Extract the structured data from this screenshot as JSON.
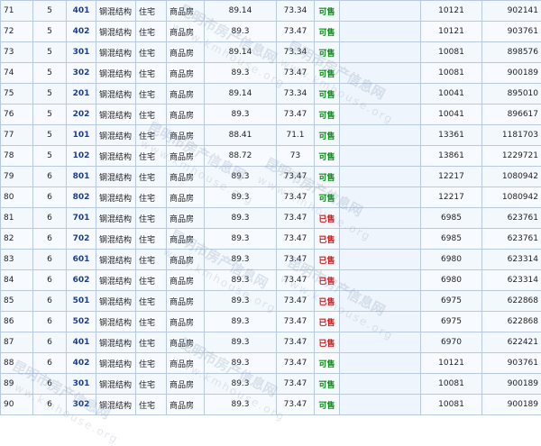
{
  "rows": [
    {
      "no": "71",
      "floor": "5",
      "room": "401",
      "structure": "钢混结构",
      "use": "住宅",
      "type": "商品房",
      "area1": "89.14",
      "area2": "73.34",
      "status": "可售",
      "status_kind": "sale",
      "price": "10121",
      "total": "902141"
    },
    {
      "no": "72",
      "floor": "5",
      "room": "402",
      "structure": "钢混结构",
      "use": "住宅",
      "type": "商品房",
      "area1": "89.3",
      "area2": "73.47",
      "status": "可售",
      "status_kind": "sale",
      "price": "10121",
      "total": "903761"
    },
    {
      "no": "73",
      "floor": "5",
      "room": "301",
      "structure": "钢混结构",
      "use": "住宅",
      "type": "商品房",
      "area1": "89.14",
      "area2": "73.34",
      "status": "可售",
      "status_kind": "sale",
      "price": "10081",
      "total": "898576"
    },
    {
      "no": "74",
      "floor": "5",
      "room": "302",
      "structure": "钢混结构",
      "use": "住宅",
      "type": "商品房",
      "area1": "89.3",
      "area2": "73.47",
      "status": "可售",
      "status_kind": "sale",
      "price": "10081",
      "total": "900189"
    },
    {
      "no": "75",
      "floor": "5",
      "room": "201",
      "structure": "钢混结构",
      "use": "住宅",
      "type": "商品房",
      "area1": "89.14",
      "area2": "73.34",
      "status": "可售",
      "status_kind": "sale",
      "price": "10041",
      "total": "895010"
    },
    {
      "no": "76",
      "floor": "5",
      "room": "202",
      "structure": "钢混结构",
      "use": "住宅",
      "type": "商品房",
      "area1": "89.3",
      "area2": "73.47",
      "status": "可售",
      "status_kind": "sale",
      "price": "10041",
      "total": "896617"
    },
    {
      "no": "77",
      "floor": "5",
      "room": "101",
      "structure": "钢混结构",
      "use": "住宅",
      "type": "商品房",
      "area1": "88.41",
      "area2": "71.1",
      "status": "可售",
      "status_kind": "sale",
      "price": "13361",
      "total": "1181703"
    },
    {
      "no": "78",
      "floor": "5",
      "room": "102",
      "structure": "钢混结构",
      "use": "住宅",
      "type": "商品房",
      "area1": "88.72",
      "area2": "73",
      "status": "可售",
      "status_kind": "sale",
      "price": "13861",
      "total": "1229721"
    },
    {
      "no": "79",
      "floor": "6",
      "room": "801",
      "structure": "钢混结构",
      "use": "住宅",
      "type": "商品房",
      "area1": "89.3",
      "area2": "73.47",
      "status": "可售",
      "status_kind": "sale",
      "price": "12217",
      "total": "1080942"
    },
    {
      "no": "80",
      "floor": "6",
      "room": "802",
      "structure": "钢混结构",
      "use": "住宅",
      "type": "商品房",
      "area1": "89.3",
      "area2": "73.47",
      "status": "可售",
      "status_kind": "sale",
      "price": "12217",
      "total": "1080942"
    },
    {
      "no": "81",
      "floor": "6",
      "room": "701",
      "structure": "钢混结构",
      "use": "住宅",
      "type": "商品房",
      "area1": "89.3",
      "area2": "73.47",
      "status": "已售",
      "status_kind": "sold",
      "price": "6985",
      "total": "623761"
    },
    {
      "no": "82",
      "floor": "6",
      "room": "702",
      "structure": "钢混结构",
      "use": "住宅",
      "type": "商品房",
      "area1": "89.3",
      "area2": "73.47",
      "status": "已售",
      "status_kind": "sold",
      "price": "6985",
      "total": "623761"
    },
    {
      "no": "83",
      "floor": "6",
      "room": "601",
      "structure": "钢混结构",
      "use": "住宅",
      "type": "商品房",
      "area1": "89.3",
      "area2": "73.47",
      "status": "已售",
      "status_kind": "sold",
      "price": "6980",
      "total": "623314"
    },
    {
      "no": "84",
      "floor": "6",
      "room": "602",
      "structure": "钢混结构",
      "use": "住宅",
      "type": "商品房",
      "area1": "89.3",
      "area2": "73.47",
      "status": "已售",
      "status_kind": "sold",
      "price": "6980",
      "total": "623314"
    },
    {
      "no": "85",
      "floor": "6",
      "room": "501",
      "structure": "钢混结构",
      "use": "住宅",
      "type": "商品房",
      "area1": "89.3",
      "area2": "73.47",
      "status": "已售",
      "status_kind": "sold",
      "price": "6975",
      "total": "622868"
    },
    {
      "no": "86",
      "floor": "6",
      "room": "502",
      "structure": "钢混结构",
      "use": "住宅",
      "type": "商品房",
      "area1": "89.3",
      "area2": "73.47",
      "status": "已售",
      "status_kind": "sold",
      "price": "6975",
      "total": "622868"
    },
    {
      "no": "87",
      "floor": "6",
      "room": "401",
      "structure": "钢混结构",
      "use": "住宅",
      "type": "商品房",
      "area1": "89.3",
      "area2": "73.47",
      "status": "已售",
      "status_kind": "sold",
      "price": "6970",
      "total": "622421"
    },
    {
      "no": "88",
      "floor": "6",
      "room": "402",
      "structure": "钢混结构",
      "use": "住宅",
      "type": "商品房",
      "area1": "89.3",
      "area2": "73.47",
      "status": "可售",
      "status_kind": "sale",
      "price": "10121",
      "total": "903761"
    },
    {
      "no": "89",
      "floor": "6",
      "room": "301",
      "structure": "钢混结构",
      "use": "住宅",
      "type": "商品房",
      "area1": "89.3",
      "area2": "73.47",
      "status": "可售",
      "status_kind": "sale",
      "price": "10081",
      "total": "900189"
    },
    {
      "no": "90",
      "floor": "6",
      "room": "302",
      "structure": "钢混结构",
      "use": "住宅",
      "type": "商品房",
      "area1": "89.3",
      "area2": "73.47",
      "status": "可售",
      "status_kind": "sale",
      "price": "10081",
      "total": "900189"
    }
  ],
  "watermark": {
    "cn": "昆明市房产信息网",
    "en": "www.kmhouse.org"
  },
  "colors": {
    "sale": "#118a1c",
    "sold": "#d11b1b",
    "room": "#1c3d8f",
    "border": "#b9c9df"
  }
}
